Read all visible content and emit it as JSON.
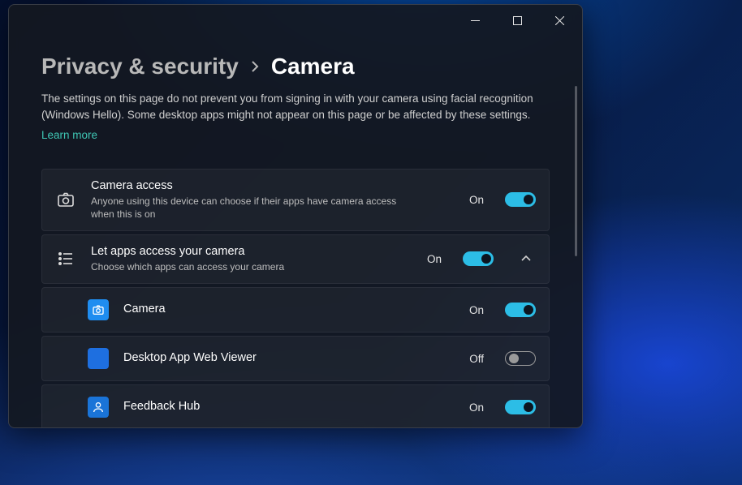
{
  "breadcrumb": {
    "parent": "Privacy & security",
    "current": "Camera"
  },
  "description": "The settings on this page do not prevent you from signing in with your camera using facial recognition (Windows Hello). Some desktop apps might not appear on this page or be affected by these settings.",
  "learn_more": "Learn more",
  "camera_access": {
    "title": "Camera access",
    "subtitle": "Anyone using this device can choose if their apps have camera access when this is on",
    "state": "On",
    "on": true
  },
  "let_apps": {
    "title": "Let apps access your camera",
    "subtitle": "Choose which apps can access your camera",
    "state": "On",
    "on": true,
    "expanded": true
  },
  "apps": [
    {
      "name": "Camera",
      "state": "On",
      "on": true,
      "icon": "camera"
    },
    {
      "name": "Desktop App Web Viewer",
      "state": "Off",
      "on": false,
      "icon": "square"
    },
    {
      "name": "Feedback Hub",
      "state": "On",
      "on": true,
      "icon": "feedback"
    }
  ]
}
